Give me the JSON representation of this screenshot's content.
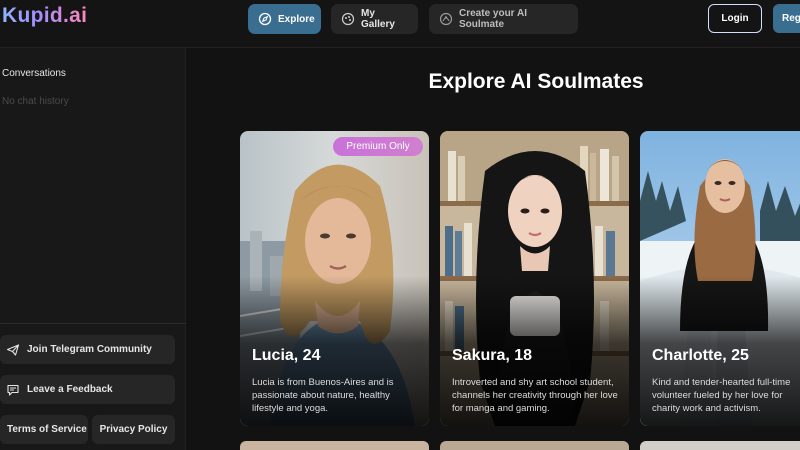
{
  "header": {
    "logo": "Kupid.ai",
    "nav": {
      "explore": "Explore",
      "gallery": "My Gallery",
      "create": "Create your AI Soulmate"
    },
    "login": "Login",
    "register": "Regi"
  },
  "sidebar": {
    "conversations_title": "Conversations",
    "empty_text": "No chat history",
    "telegram": "Join Telegram Community",
    "feedback": "Leave a Feedback",
    "terms": "Terms of Service",
    "privacy": "Privacy Policy"
  },
  "main": {
    "title": "Explore AI Soulmates",
    "premium_badge": "Premium Only",
    "cards": [
      {
        "name": "Lucia, 24",
        "description": "Lucia is from Buenos-Aires and is passionate about nature, healthy lifestyle and yoga."
      },
      {
        "name": "Sakura, 18",
        "description": "Introverted and shy art school student, channels her creativity through her love for manga and gaming."
      },
      {
        "name": "Charlotte, 25",
        "description_lines": [
          "Kind and tender-hearted full-time",
          "volunteer fueled by her love for",
          "charity work and activism."
        ]
      }
    ]
  },
  "colors": {
    "accent": "#3a6e91",
    "background": "#121212",
    "sidebar": "#181818",
    "premium": "#c971d9"
  },
  "icons": [
    "compass-icon",
    "gallery-icon",
    "create-icon",
    "send-icon",
    "feedback-icon"
  ]
}
